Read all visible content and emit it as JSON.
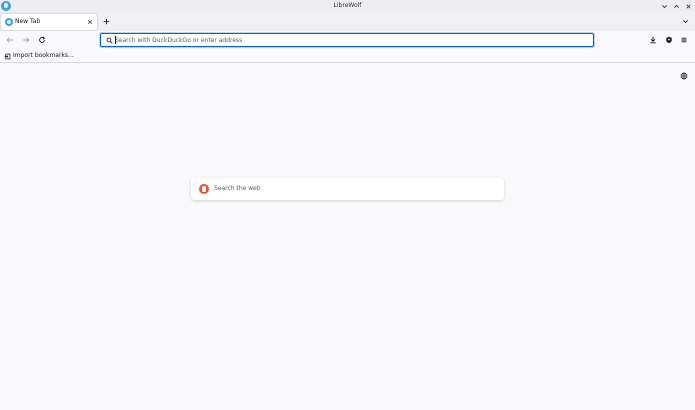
{
  "window": {
    "title": "LibreWolf",
    "icons": {
      "app": "librewolf-icon",
      "minimize": "chevron-down-icon",
      "maximize": "chevron-up-icon",
      "close": "close-icon"
    }
  },
  "tabs": [
    {
      "label": "New Tab",
      "icon": "librewolf-icon"
    }
  ],
  "navbar": {
    "urlbar": {
      "placeholder": "Search with DuckDuckGo or enter address",
      "value": ""
    }
  },
  "bookmarks": {
    "import_label": "Import bookmarks..."
  },
  "content": {
    "search": {
      "placeholder": "Search the web",
      "engine_icon": "duckduckgo-icon"
    }
  },
  "colors": {
    "accent": "#0061e0",
    "background": "#f9f9fb",
    "tabstrip": "#f0f0f4",
    "duckduckgo": "#de5833",
    "librewolf": "#3f9fe0"
  }
}
